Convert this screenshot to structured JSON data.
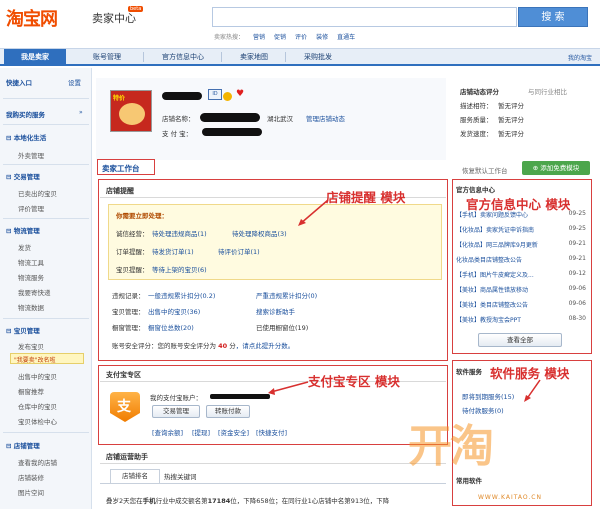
{
  "header": {
    "logo": "淘宝网",
    "logo_sub": "卖家中心",
    "beta": "beta",
    "search_button": "搜 索",
    "hot_label": "卖家热搜：",
    "hot_links": [
      "营销",
      "促销",
      "评价",
      "装修",
      "直通车"
    ]
  },
  "nav": {
    "tabs": [
      "我是卖家",
      "账号管理",
      "官方信息中心",
      "卖家地图",
      "采购批发"
    ],
    "my_taobao": "我的淘宝"
  },
  "sidebar": {
    "quick_entry": "快捷入口",
    "settings": "设置",
    "bought_service": "我购买的服务",
    "local_life": "本地化生活",
    "takeout": "外卖管理",
    "trade": "交易管理",
    "trade_items": [
      "已卖出的宝贝",
      "评价管理"
    ],
    "logistics": "物流管理",
    "logistics_items": [
      "发货",
      "物流工具",
      "物流服务",
      "我要寄快递",
      "物流数据"
    ],
    "items": "宝贝管理",
    "items_items": [
      "发布宝贝",
      "\"我要卖\"改名啦",
      "出售中的宝贝",
      "橱窗推荐",
      "仓库中的宝贝",
      "宝贝体检中心"
    ],
    "shop": "店铺管理",
    "shop_items": [
      "查看我的店铺",
      "店铺装修",
      "图片空间"
    ]
  },
  "profile": {
    "shop_name_label": "店铺名称：",
    "location": "湖北武汉",
    "shop_manage": "管理店铺动态",
    "alipay_label": "支 付 宝："
  },
  "shop_score": {
    "title": "店铺动态评分",
    "compare": "与同行业相比",
    "rows": [
      {
        "label": "描述相符：",
        "value": "暂无评分"
      },
      {
        "label": "服务质量：",
        "value": "暂无评分"
      },
      {
        "label": "发货速度：",
        "value": "暂无评分"
      }
    ]
  },
  "workbench": {
    "title": "卖家工作台",
    "restore": "恢复默认工作台",
    "add": "添加免费模块"
  },
  "reminder": {
    "title": "店铺提醒",
    "todo": "你需要立即处理：",
    "rows": [
      {
        "label": "诚信经营：",
        "a": "待处理违规商品(1)",
        "b": "待处理降权商品(3)"
      },
      {
        "label": "订单提醒：",
        "a": "待发货订单(1)",
        "b": "待评价订单(1)"
      },
      {
        "label": "宝贝提醒：",
        "a": "等待上架的宝贝(6)",
        "b": ""
      }
    ],
    "stats": [
      {
        "label": "违规记录：",
        "a": "一般违规累计扣分(0.2)",
        "b": "严重违规累计扣分(0)"
      },
      {
        "label": "宝贝管理：",
        "a": "出售中的宝贝(36)",
        "b": "搜索诊断助手"
      },
      {
        "label": "橱窗管理：",
        "a": "橱窗位总数(20)",
        "b": "已使用橱窗位(19)"
      }
    ],
    "security_text": "账号安全评分：您的账号安全评分为",
    "security_score": "40",
    "security_unit": "分",
    "security_tail": "，请点此提升分数。"
  },
  "official": {
    "title": "官方信息中心",
    "items": [
      {
        "text": "【手机】卖家问题反馈中心",
        "date": "09-25"
      },
      {
        "text": "【化妆品】卖家凭证申诉指南",
        "date": "09-25"
      },
      {
        "text": "【化妆品】网三品牌库9月更新",
        "date": "09-21"
      },
      {
        "text": "化妆品类目店铺整改公告",
        "date": "09-21"
      },
      {
        "text": "【手机】图片牛皮癣定义及...",
        "date": "09-12"
      },
      {
        "text": "【美妆】商品属性错放移动",
        "date": "09-06"
      },
      {
        "text": "【美妆】类目店铺整改公告",
        "date": "09-06"
      },
      {
        "text": "【美妆】教授淘宝会PPT",
        "date": "08-30"
      }
    ],
    "view_all": "查看全部"
  },
  "alipay": {
    "title": "支付宝专区",
    "account_label": "我的支付宝账户：",
    "btn_trade": "交易管理",
    "btn_pay": "转账付款",
    "links": [
      "[查询余额]",
      "[提现]",
      "[资金安全]",
      "[快捷支付]"
    ]
  },
  "software": {
    "title": "软件服务",
    "expiring": "即将到期服务(15)",
    "pending": "待付款服务(0)",
    "common": "常用软件"
  },
  "ops": {
    "title": "店铺运营助手",
    "tabs": [
      "店铺排名",
      "热搜关键词"
    ],
    "row_start": "叠岁2天您在",
    "row_cat": "手机",
    "row_mid": "行业中成交额名第",
    "row_rank": "17184",
    "row_tail": "位，下降658位；在同行业1心店铺中名第913位，下降"
  },
  "annotations": {
    "reminder": "店铺提醒 模块",
    "official": "官方信息中心 模块",
    "alipay": "支付宝专区 模块",
    "software": "软件服务 模块"
  },
  "watermark": {
    "text": "WWW.KAITAO.CN"
  }
}
